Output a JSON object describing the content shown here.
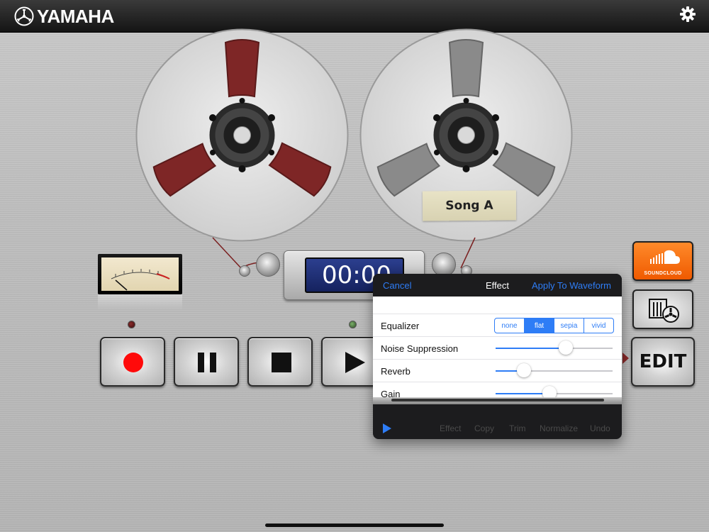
{
  "app": {
    "brand": "YAMAHA"
  },
  "icons": {
    "logo": "yamaha-tuning-fork-icon",
    "settings": "gear-icon",
    "soundcloud": "soundcloud-icon",
    "library": "tape-library-icon"
  },
  "tape": {
    "label": "Song A"
  },
  "counter": {
    "time": "00:00"
  },
  "transport": {
    "record": "record",
    "pause": "pause",
    "stop": "stop",
    "play": "play"
  },
  "side": {
    "soundcloud_label": "SOUNDCLOUD",
    "edit_label": "EDIT"
  },
  "effect_popover": {
    "cancel": "Cancel",
    "title": "Effect",
    "apply": "Apply To Waveform",
    "equalizer": {
      "label": "Equalizer",
      "options": [
        "none",
        "flat",
        "sepia",
        "vivid"
      ],
      "selected": "flat"
    },
    "noise_suppression": {
      "label": "Noise Suppression",
      "value": 0.6
    },
    "reverb": {
      "label": "Reverb",
      "value": 0.24
    },
    "gain": {
      "label": "Gain",
      "value": 0.46
    }
  },
  "edit_toolbar": {
    "items": [
      "Effect",
      "Copy",
      "Trim",
      "Normalize",
      "Undo"
    ]
  },
  "colors": {
    "accent": "#2e7df6",
    "reel_red": "#7e2626",
    "reel_grey": "#8a8a8a",
    "soundcloud_orange": "#f26a10",
    "counter_blue": "#1d2d73"
  }
}
